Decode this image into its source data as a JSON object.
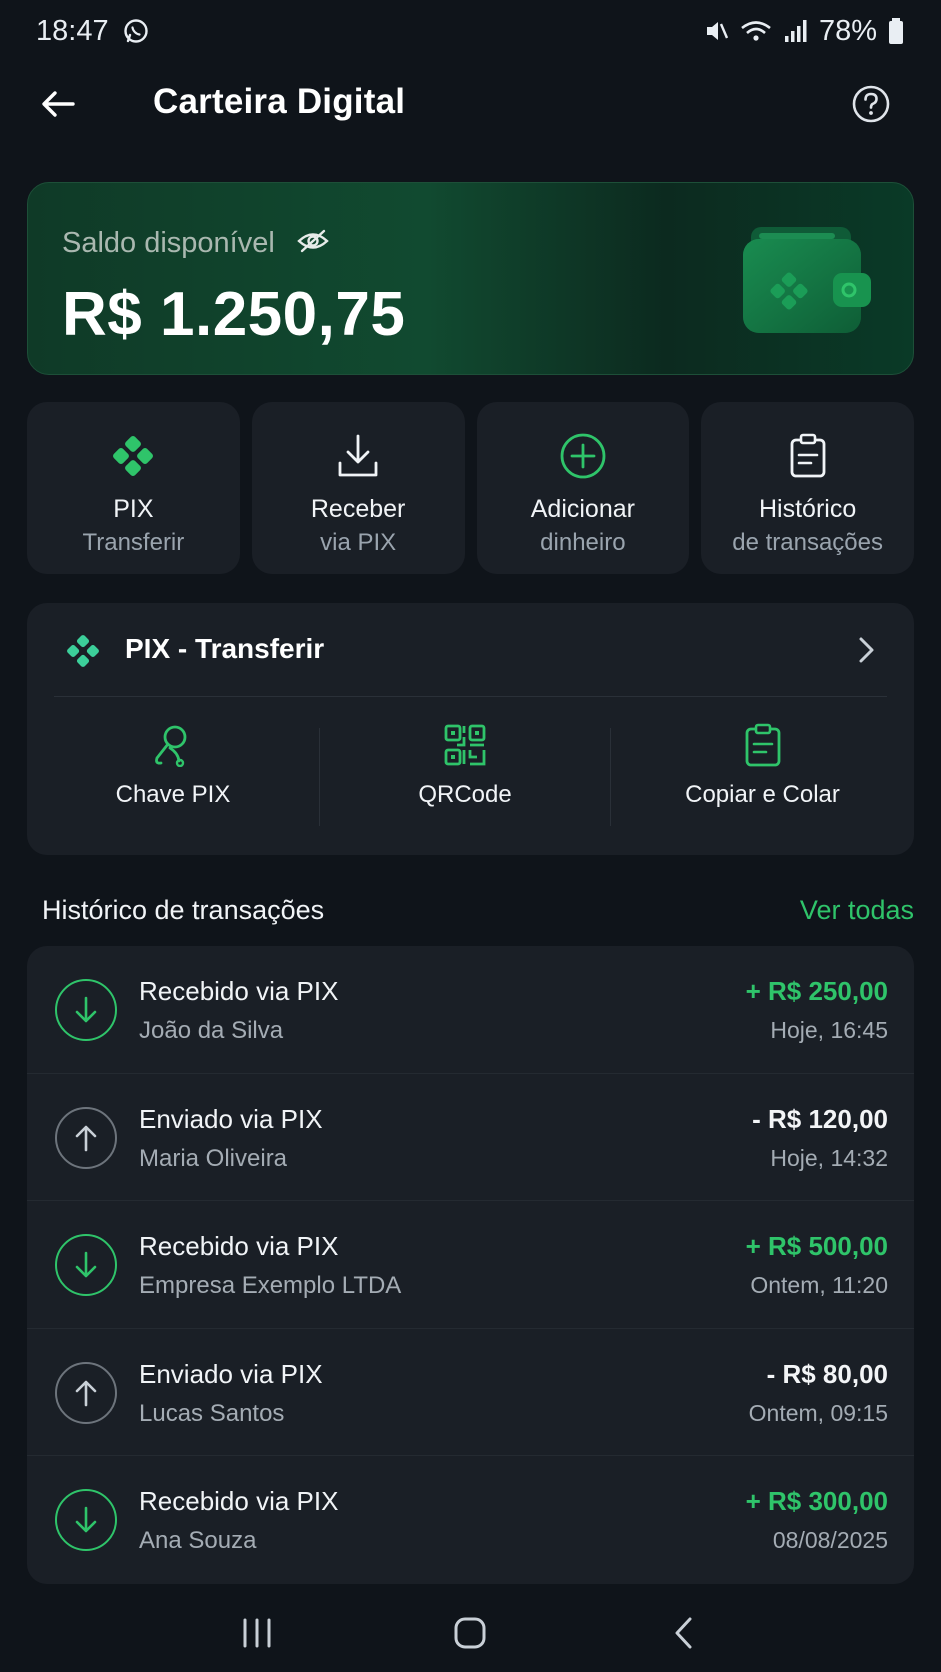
{
  "status_bar": {
    "time": "18:47",
    "battery": "78%"
  },
  "header": {
    "title": "Carteira Digital"
  },
  "balance": {
    "label": "Saldo disponível",
    "value": "R$ 1.250,75"
  },
  "quick_actions": [
    {
      "title": "PIX",
      "subtitle": "Transferir",
      "icon": "pix-icon"
    },
    {
      "title": "Receber",
      "subtitle": "via PIX",
      "icon": "download-icon"
    },
    {
      "title": "Adicionar",
      "subtitle": "dinheiro",
      "icon": "plus-circle-icon"
    },
    {
      "title": "Histórico",
      "subtitle": "de transações",
      "icon": "clipboard-icon"
    }
  ],
  "pix_card": {
    "title": "PIX - Transferir",
    "options": [
      {
        "label": "Chave PIX",
        "icon": "key-icon"
      },
      {
        "label": "QRCode",
        "icon": "qrcode-icon"
      },
      {
        "label": "Copiar e Colar",
        "icon": "clipboard-icon"
      }
    ]
  },
  "history": {
    "title": "Histórico de transações",
    "see_all": "Ver todas",
    "transactions": [
      {
        "title": "Recebido via PIX",
        "name": "João da Silva",
        "amount": "+ R$ 250,00",
        "date": "Hoje, 16:45",
        "direction": "in"
      },
      {
        "title": "Enviado via PIX",
        "name": "Maria Oliveira",
        "amount": "- R$ 120,00",
        "date": "Hoje, 14:32",
        "direction": "out"
      },
      {
        "title": "Recebido via PIX",
        "name": "Empresa Exemplo LTDA",
        "amount": "+ R$ 500,00",
        "date": "Ontem, 11:20",
        "direction": "in"
      },
      {
        "title": "Enviado via PIX",
        "name": "Lucas Santos",
        "amount": "- R$ 80,00",
        "date": "Ontem, 09:15",
        "direction": "out"
      },
      {
        "title": "Recebido via PIX",
        "name": "Ana Souza",
        "amount": "+ R$ 300,00",
        "date": "08/08/2025",
        "direction": "in"
      }
    ]
  },
  "colors": {
    "accent": "#2fc46a",
    "background": "#0f141a",
    "card": "#1a1f26"
  }
}
